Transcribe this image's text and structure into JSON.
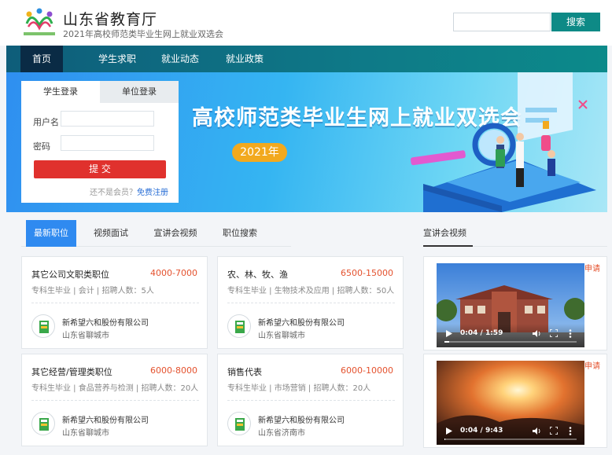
{
  "header": {
    "title": "山东省教育厅",
    "subtitle": "2021年高校师范类毕业生网上就业双选会",
    "logo_url_text": "www.sdjy-edu.edu.cn",
    "search_placeholder": "",
    "search_button": "搜索"
  },
  "nav": {
    "items": [
      {
        "label": "首页",
        "active": true
      },
      {
        "label": "学生求职",
        "active": false
      },
      {
        "label": "就业动态",
        "active": false
      },
      {
        "label": "就业政策",
        "active": false
      }
    ]
  },
  "banner": {
    "title": "高校师范类毕业生网上就业双选会",
    "badge": "2021年"
  },
  "login": {
    "tabs": [
      "学生登录",
      "单位登录"
    ],
    "username_label": "用户名",
    "password_label": "密码",
    "username_value": "",
    "password_value": "",
    "submit": "提 交",
    "not_member": "还不是会员？",
    "register": "免费注册"
  },
  "content_tabs": [
    "最新职位",
    "视频面试",
    "宣讲会视频",
    "职位搜索"
  ],
  "side_heading": "宣讲会视频",
  "jobs": [
    {
      "title": "其它公司文职类职位",
      "salary": "4000-7000",
      "meta": "专科生毕业 | 会计 | 招聘人数：5人",
      "company": "新希望六和股份有限公司",
      "location": "山东省聊城市"
    },
    {
      "title": "农、林、牧、渔",
      "salary": "6500-15000",
      "meta": "专科生毕业 | 生物技术及应用 | 招聘人数：50人",
      "company": "新希望六和股份有限公司",
      "location": "山东省聊城市"
    },
    {
      "title": "其它经营/管理类职位",
      "salary": "6000-8000",
      "meta": "专科生毕业 | 食品营养与检测 | 招聘人数：20人",
      "company": "新希望六和股份有限公司",
      "location": "山东省聊城市"
    },
    {
      "title": "销售代表",
      "salary": "6000-10000",
      "meta": "专科生毕业 | 市场营销 | 招聘人数：20人",
      "company": "新希望六和股份有限公司",
      "location": "山东省济南市"
    }
  ],
  "videos": [
    {
      "apply": "申请",
      "time": "0:04 / 1:59",
      "progress": 0.034
    },
    {
      "apply": "申请",
      "time": "0:04 / 9:43",
      "progress": 0.007
    }
  ],
  "colors": {
    "accent_teal": "#0e8a86",
    "nav_active": "#0a2b45",
    "tab_active": "#2f8af0",
    "submit_red": "#e0312d",
    "salary_orange": "#e4522e"
  }
}
